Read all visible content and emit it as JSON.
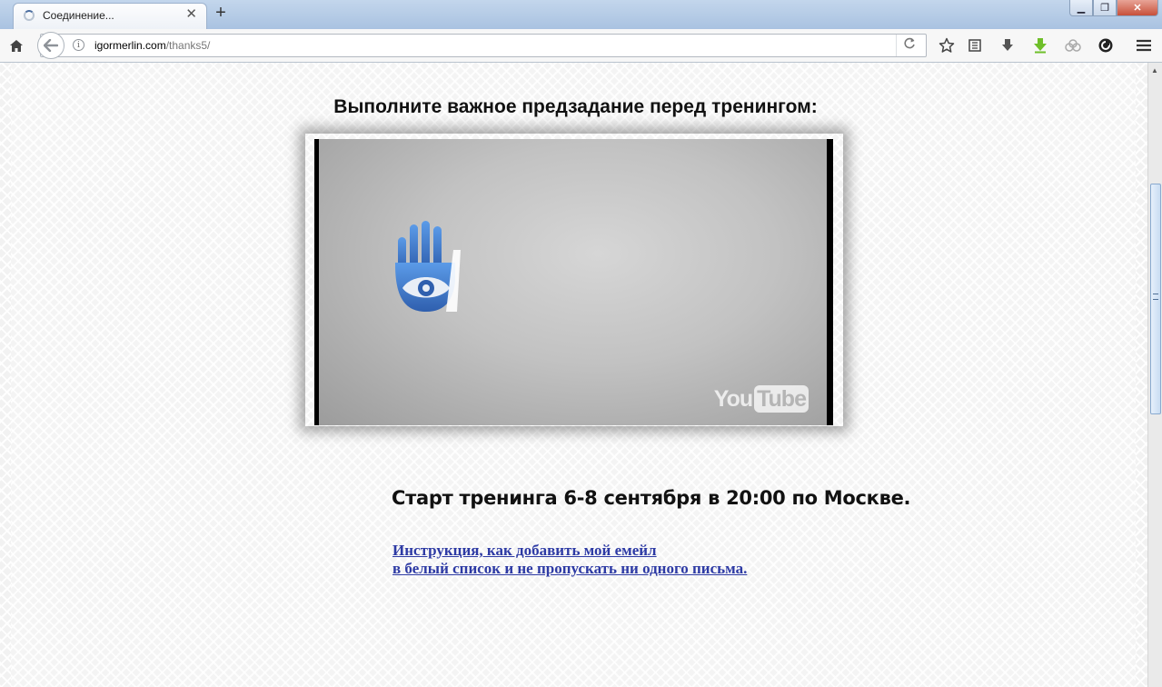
{
  "browser": {
    "tab": {
      "title": "Соединение...",
      "close_glyph": "✕"
    },
    "new_tab_glyph": "+",
    "window_controls": {
      "minimize": "▁",
      "restore": "❐",
      "close": "✕"
    },
    "address": {
      "host": "igormerlin.com",
      "path": "/thanks5/"
    }
  },
  "page": {
    "heading": "Выполните важное предзадание перед тренингом:",
    "video": {
      "watermark_you": "You",
      "watermark_tube": "Tube"
    },
    "start_text": "Старт тренинга 6-8 сентября в 20:00 по Москве.",
    "instruction_link": {
      "line1": "Инструкция, как добавить мой емейл",
      "line2": "в белый список и не пропускать ни одного письма."
    }
  },
  "colors": {
    "link": "#2d3aa4",
    "hand_logo_blue": "#3b74c9",
    "tab_strip": "#aec6e3"
  }
}
